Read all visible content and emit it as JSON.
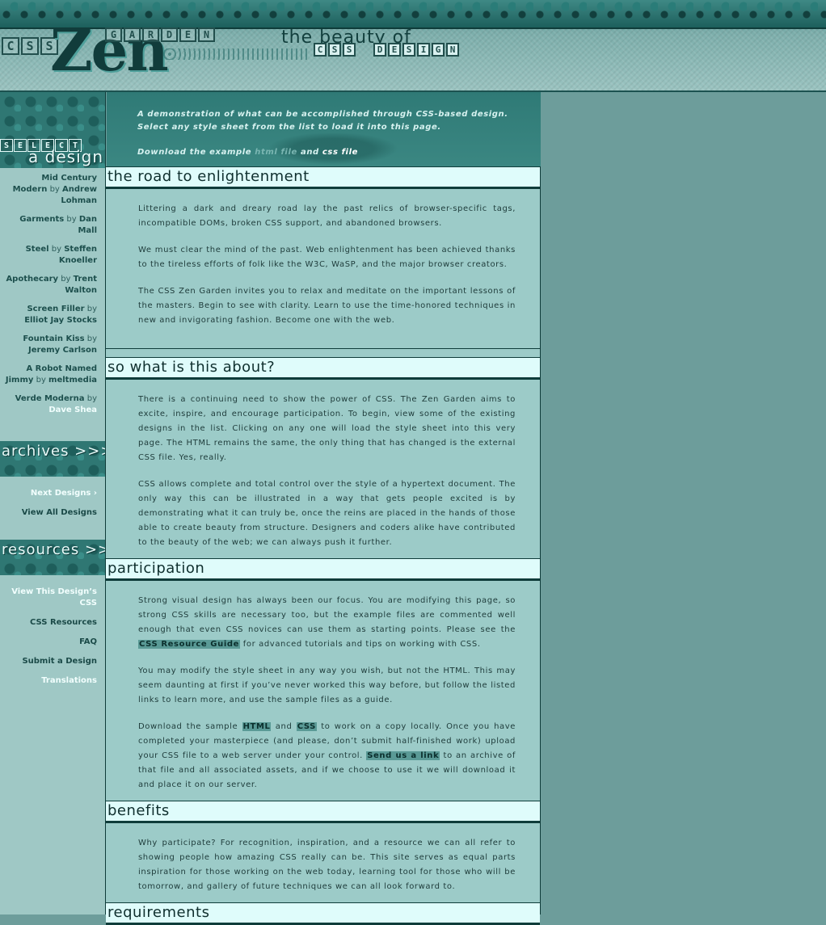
{
  "header": {
    "logo_css": [
      "C",
      "S",
      "S"
    ],
    "logo_zen": "Zen",
    "logo_garden": [
      "G",
      "A",
      "R",
      "D",
      "E",
      "N"
    ],
    "tagline": "the beauty of",
    "tagline_css": [
      "C",
      "S",
      "S"
    ],
    "tagline_design": [
      "D",
      "E",
      "S",
      "I",
      "G",
      "N"
    ]
  },
  "intro": {
    "p1": "A demonstration of what can be accomplished through CSS-based design. Select any style sheet from the list to load it into this page.",
    "download_prefix": "Download the example",
    "html_file": "html file",
    "and": "and",
    "css_file": "css file"
  },
  "sidebar": {
    "select_letters": [
      "S",
      "E",
      "L",
      "E",
      "C",
      "T"
    ],
    "select_title": "a design",
    "designs": [
      {
        "name": "Mid Century Modern",
        "by": "by",
        "author": "Andrew Lohman"
      },
      {
        "name": "Garments",
        "by": "by",
        "author": "Dan Mall"
      },
      {
        "name": "Steel",
        "by": "by",
        "author": "Steffen Knoeller"
      },
      {
        "name": "Apothecary",
        "by": "by",
        "author": "Trent Walton"
      },
      {
        "name": "Screen Filler",
        "by": "by",
        "author": "Elliot Jay Stocks"
      },
      {
        "name": "Fountain Kiss",
        "by": "by",
        "author": "Jeremy Carlson"
      },
      {
        "name": "A Robot Named Jimmy",
        "by": "by",
        "author": "meltmedia"
      },
      {
        "name": "Verde Moderna",
        "by": "by",
        "author": "Dave Shea"
      }
    ],
    "archives_title": "archives >>>",
    "next_designs": "Next Designs ›",
    "view_all": "View All Designs",
    "resources_title": "resources >>>",
    "resources": [
      "View This Design’s CSS",
      "CSS Resources",
      "FAQ",
      "Submit a Design",
      "Translations"
    ]
  },
  "sections": {
    "road": {
      "title": "the road to enlightenment",
      "p1": "Littering a dark and dreary road lay the past relics of browser-specific tags, incompatible DOMs, broken CSS support, and abandoned browsers.",
      "p2": "We must clear the mind of the past. Web enlightenment has been achieved thanks to the tireless efforts of folk like the W3C, WaSP, and the major browser creators.",
      "p3": "The CSS Zen Garden invites you to relax and meditate on the important lessons of the masters. Begin to see with clarity. Learn to use the time-honored techniques in new and invigorating fashion. Become one with the web."
    },
    "about": {
      "title": "so what is this about?",
      "p1": "There is a continuing need to show the power of CSS. The Zen Garden aims to excite, inspire, and encourage participation. To begin, view some of the existing designs in the list. Clicking on any one will load the style sheet into this very page. The HTML remains the same, the only thing that has changed is the external CSS file. Yes, really.",
      "p2": "CSS allows complete and total control over the style of a hypertext document. The only way this can be illustrated in a way that gets people excited is by demonstrating what it can truly be, once the reins are placed in the hands of those able to create beauty from structure. Designers and coders alike have contributed to the beauty of the web; we can always push it further."
    },
    "participation": {
      "title": "participation",
      "p1_a": "Strong visual design has always been our focus. You are modifying this page, so strong CSS skills are necessary too, but the example files are commented well enough that even CSS novices can use them as starting points. Please see the",
      "p1_link": "CSS Resource Guide",
      "p1_b": "for advanced tutorials and tips on working with CSS.",
      "p2": "You may modify the style sheet in any way you wish, but not the HTML. This may seem daunting at first if you’ve never worked this way before, but follow the listed links to learn more, and use the sample files as a guide.",
      "p3_a": "Download the sample",
      "p3_html": "HTML",
      "p3_and": "and",
      "p3_css": "CSS",
      "p3_b": "to work on a copy locally. Once you have completed your masterpiece (and please, don’t submit half-finished work) upload your CSS file to a web server under your control.",
      "p3_link": "Send us a link",
      "p3_c": "to an archive of that file and all associated assets, and if we choose to use it we will download it and place it on our server."
    },
    "benefits": {
      "title": "benefits",
      "p1": "Why participate? For recognition, inspiration, and a resource we can all refer to showing people how amazing CSS really can be. This site serves as equal parts inspiration for those working on the web today, learning tool for those who will be tomorrow, and gallery of future techniques we can all look forward to."
    },
    "requirements": {
      "title": "requirements"
    }
  }
}
